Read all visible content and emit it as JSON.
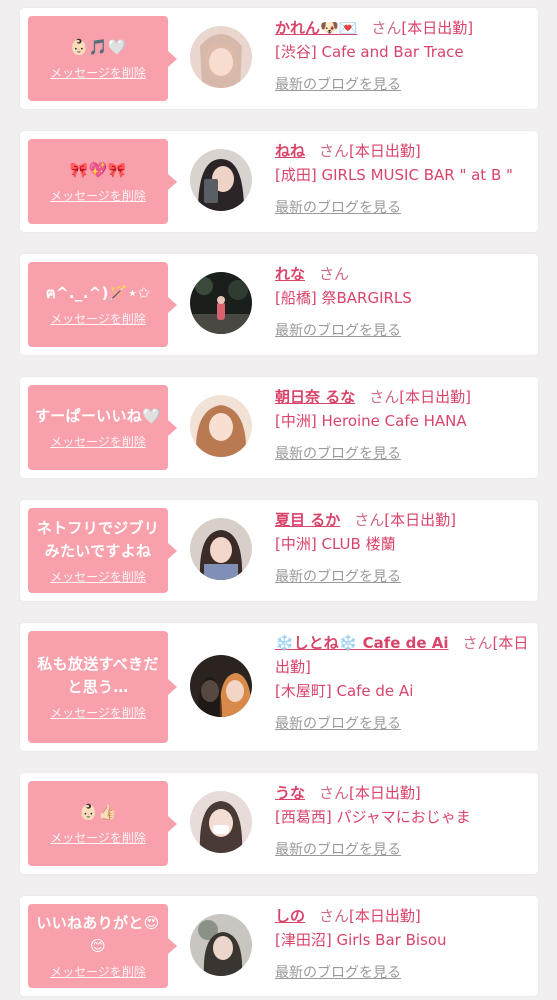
{
  "common": {
    "delete_label": "メッセージを削除",
    "san": "さん",
    "blog_label": "最新のブログを見る"
  },
  "colors": {
    "bubble": "#f8a0ac",
    "name": "#d9446a",
    "background": "#f1eff0"
  },
  "items": [
    {
      "message": "👶🏻🎵🤍",
      "name": "かれん🐶💌",
      "status": "[本日出勤]",
      "shop": "[渋谷] Cafe and Bar Trace"
    },
    {
      "message": "🎀💖🎀",
      "name": "ねね",
      "status": "[本日出勤]",
      "shop": "[成田] GIRLS MUSIC BAR \" at B \""
    },
    {
      "message": "ฅ^._.^)🪄⋆✩",
      "name": "れな",
      "status": "",
      "shop": "[船橋] 祭BARGIRLS"
    },
    {
      "message": "すーぱーいいね🤍",
      "name": "朝日奈 るな",
      "status": "[本日出勤]",
      "shop": "[中洲] Heroine Cafe HANA"
    },
    {
      "message": "ネトフリでジブリみたいですよね",
      "name": "夏目 るか",
      "status": "[本日出勤]",
      "shop": "[中洲] CLUB 楼蘭"
    },
    {
      "message": "私も放送すべきだと思う…",
      "name": "❄️しとね❄️ Cafe de Ai",
      "status": "[本日出勤]",
      "shop": "[木屋町] Cafe de Ai"
    },
    {
      "message": "👶🏻👍🏻",
      "name": "うな",
      "status": "[本日出勤]",
      "shop": "[西葛西] パジャマにおじゃま"
    },
    {
      "message": "いいねありがと😍😊",
      "name": "しの",
      "status": "[本日出勤]",
      "shop": "[津田沼] Girls Bar Bisou"
    }
  ]
}
